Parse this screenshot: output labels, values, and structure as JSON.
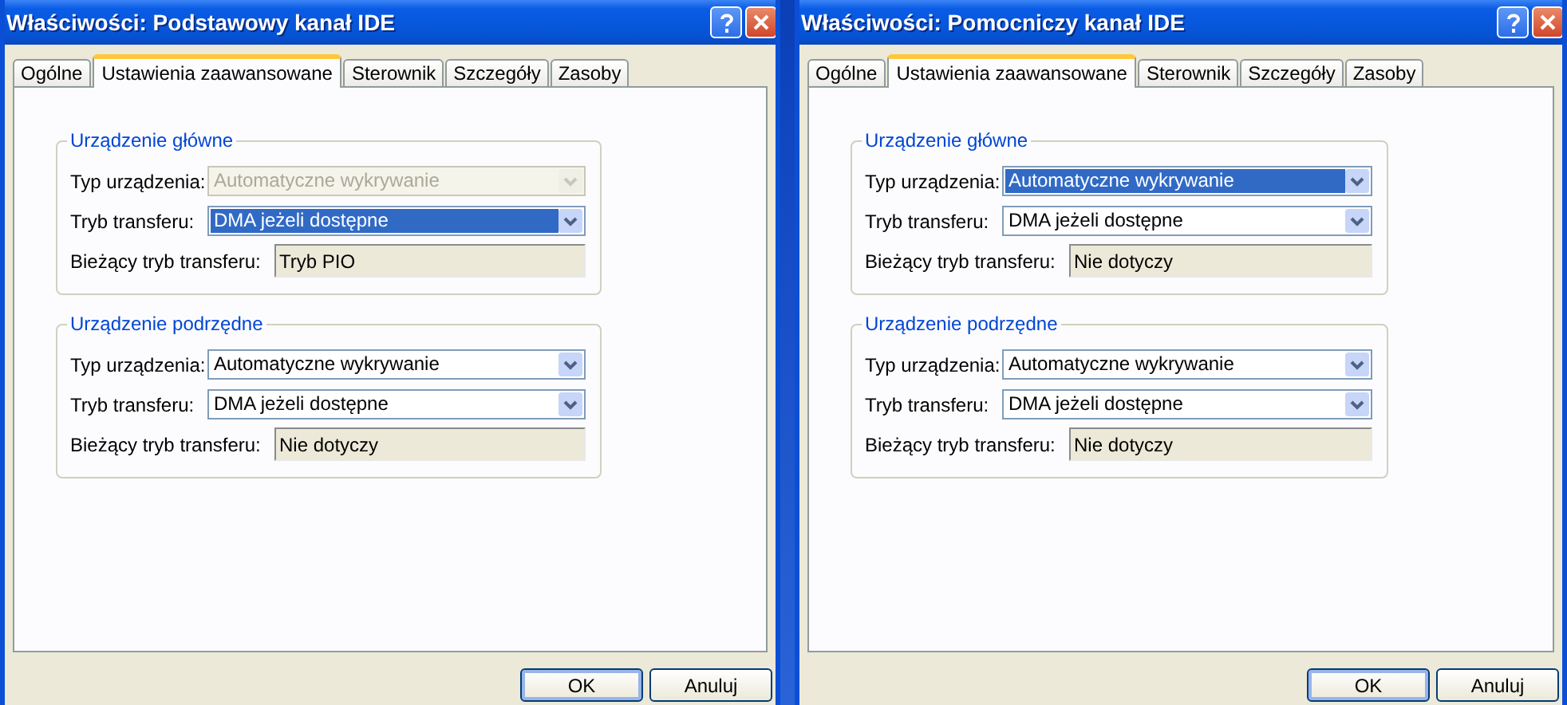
{
  "dialogs": [
    {
      "title": "Właściwości: Podstawowy kanał IDE",
      "tabs": [
        {
          "label": "Ogólne",
          "selected": false
        },
        {
          "label": "Ustawienia zaawansowane",
          "selected": true
        },
        {
          "label": "Sterownik",
          "selected": false
        },
        {
          "label": "Szczegóły",
          "selected": false
        },
        {
          "label": "Zasoby",
          "selected": false
        }
      ],
      "groups": [
        {
          "title": "Urządzenie główne",
          "rows": [
            {
              "kind": "combo",
              "label": "Typ urządzenia:",
              "value": "Automatyczne wykrywanie",
              "disabled": true,
              "highlighted": false
            },
            {
              "kind": "combo",
              "label": "Tryb transferu:",
              "value": "DMA jeżeli dostępne",
              "disabled": false,
              "highlighted": true
            },
            {
              "kind": "readonly",
              "label": "Bieżący tryb transferu:",
              "value": "Tryb PIO"
            }
          ]
        },
        {
          "title": "Urządzenie podrzędne",
          "rows": [
            {
              "kind": "combo",
              "label": "Typ urządzenia:",
              "value": "Automatyczne wykrywanie",
              "disabled": false,
              "highlighted": false
            },
            {
              "kind": "combo",
              "label": "Tryb transferu:",
              "value": "DMA jeżeli dostępne",
              "disabled": false,
              "highlighted": false
            },
            {
              "kind": "readonly",
              "label": "Bieżący tryb transferu:",
              "value": "Nie dotyczy"
            }
          ]
        }
      ],
      "buttons": [
        {
          "label": "OK",
          "default": true
        },
        {
          "label": "Anuluj",
          "default": false
        }
      ]
    },
    {
      "title": "Właściwości: Pomocniczy kanał IDE",
      "tabs": [
        {
          "label": "Ogólne",
          "selected": false
        },
        {
          "label": "Ustawienia zaawansowane",
          "selected": true
        },
        {
          "label": "Sterownik",
          "selected": false
        },
        {
          "label": "Szczegóły",
          "selected": false
        },
        {
          "label": "Zasoby",
          "selected": false
        }
      ],
      "groups": [
        {
          "title": "Urządzenie główne",
          "rows": [
            {
              "kind": "combo",
              "label": "Typ urządzenia:",
              "value": "Automatyczne wykrywanie",
              "disabled": false,
              "highlighted": true
            },
            {
              "kind": "combo",
              "label": "Tryb transferu:",
              "value": "DMA jeżeli dostępne",
              "disabled": false,
              "highlighted": false
            },
            {
              "kind": "readonly",
              "label": "Bieżący tryb transferu:",
              "value": "Nie dotyczy"
            }
          ]
        },
        {
          "title": "Urządzenie podrzędne",
          "rows": [
            {
              "kind": "combo",
              "label": "Typ urządzenia:",
              "value": "Automatyczne wykrywanie",
              "disabled": false,
              "highlighted": false
            },
            {
              "kind": "combo",
              "label": "Tryb transferu:",
              "value": "DMA jeżeli dostępne",
              "disabled": false,
              "highlighted": false
            },
            {
              "kind": "readonly",
              "label": "Bieżący tryb transferu:",
              "value": "Nie dotyczy"
            }
          ]
        }
      ],
      "buttons": [
        {
          "label": "OK",
          "default": true
        },
        {
          "label": "Anuluj",
          "default": false
        }
      ]
    }
  ]
}
